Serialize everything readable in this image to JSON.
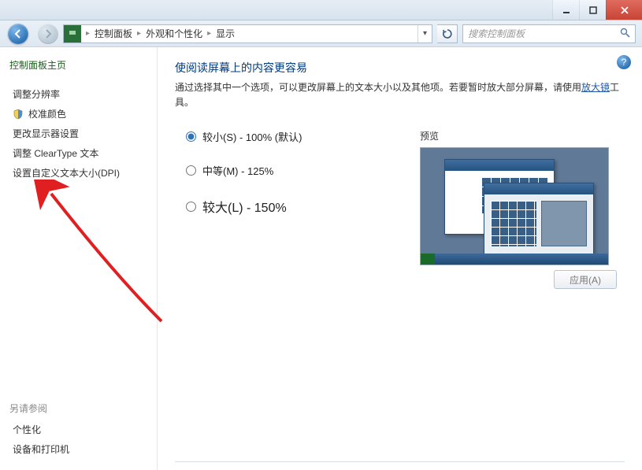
{
  "titlebar": {
    "min": "",
    "max": "",
    "close": ""
  },
  "breadcrumb": {
    "root_icon": "control-panel",
    "items": [
      "控制面板",
      "外观和个性化",
      "显示"
    ]
  },
  "search": {
    "placeholder": "搜索控制面板"
  },
  "sidebar": {
    "home": "控制面板主页",
    "links": [
      {
        "label": "调整分辨率",
        "shield": false
      },
      {
        "label": "校准颜色",
        "shield": true
      },
      {
        "label": "更改显示器设置",
        "shield": false
      },
      {
        "label": "调整 ClearType 文本",
        "shield": false
      },
      {
        "label": "设置自定义文本大小(DPI)",
        "shield": false
      }
    ],
    "seealso_header": "另请参阅",
    "seealso": [
      "个性化",
      "设备和打印机"
    ]
  },
  "main": {
    "title": "使阅读屏幕上的内容更容易",
    "desc_before": "通过选择其中一个选项，可以更改屏幕上的文本大小以及其他项。若要暂时放大部分屏幕，请使用",
    "desc_link": "放大镜",
    "desc_after": "工具。",
    "options": [
      {
        "label": "较小(S) - 100% (默认)",
        "checked": true
      },
      {
        "label": "中等(M) - 125%",
        "checked": false
      },
      {
        "label": "较大(L) - 150%",
        "checked": false
      }
    ],
    "preview_label": "预览",
    "apply": "应用(A)"
  }
}
